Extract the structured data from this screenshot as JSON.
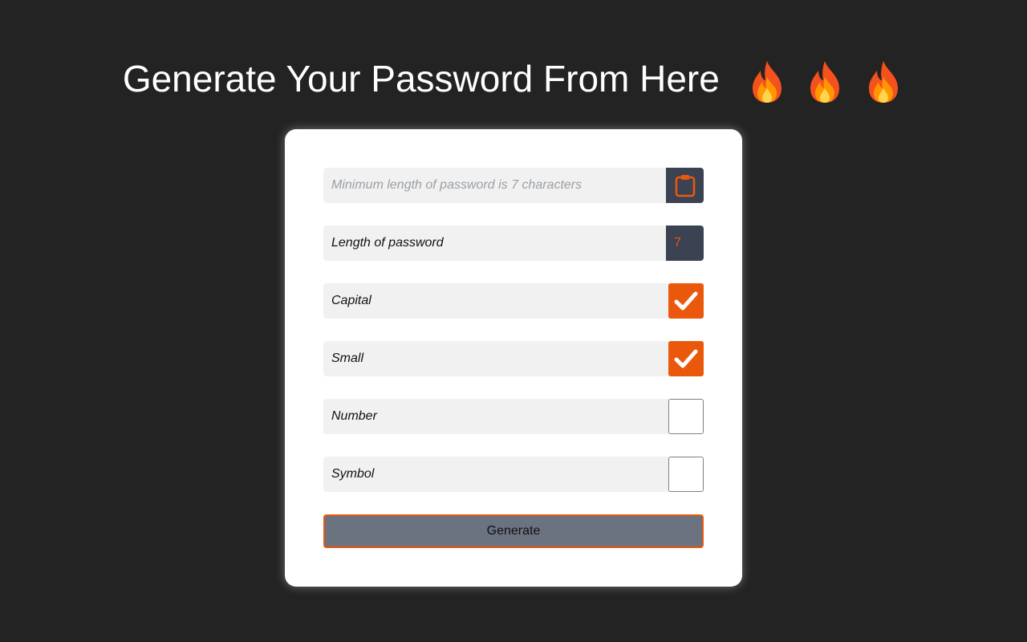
{
  "header": {
    "title": "Generate Your Password From Here",
    "icons": [
      "fire-icon",
      "fire-icon",
      "fire-icon"
    ]
  },
  "form": {
    "password_field": {
      "placeholder": "Minimum length of password is 7 characters",
      "value": "",
      "copy_icon": "clipboard-icon"
    },
    "length": {
      "label": "Length of password",
      "value": "7"
    },
    "options": [
      {
        "label": "Capital",
        "checked": true
      },
      {
        "label": "Small",
        "checked": true
      },
      {
        "label": "Number",
        "checked": false
      },
      {
        "label": "Symbol",
        "checked": false
      }
    ],
    "generate_label": "Generate"
  },
  "colors": {
    "background": "#232323",
    "accent": "#ea580c",
    "dark_slate": "#3b4252",
    "button_gray": "#6b7280"
  }
}
